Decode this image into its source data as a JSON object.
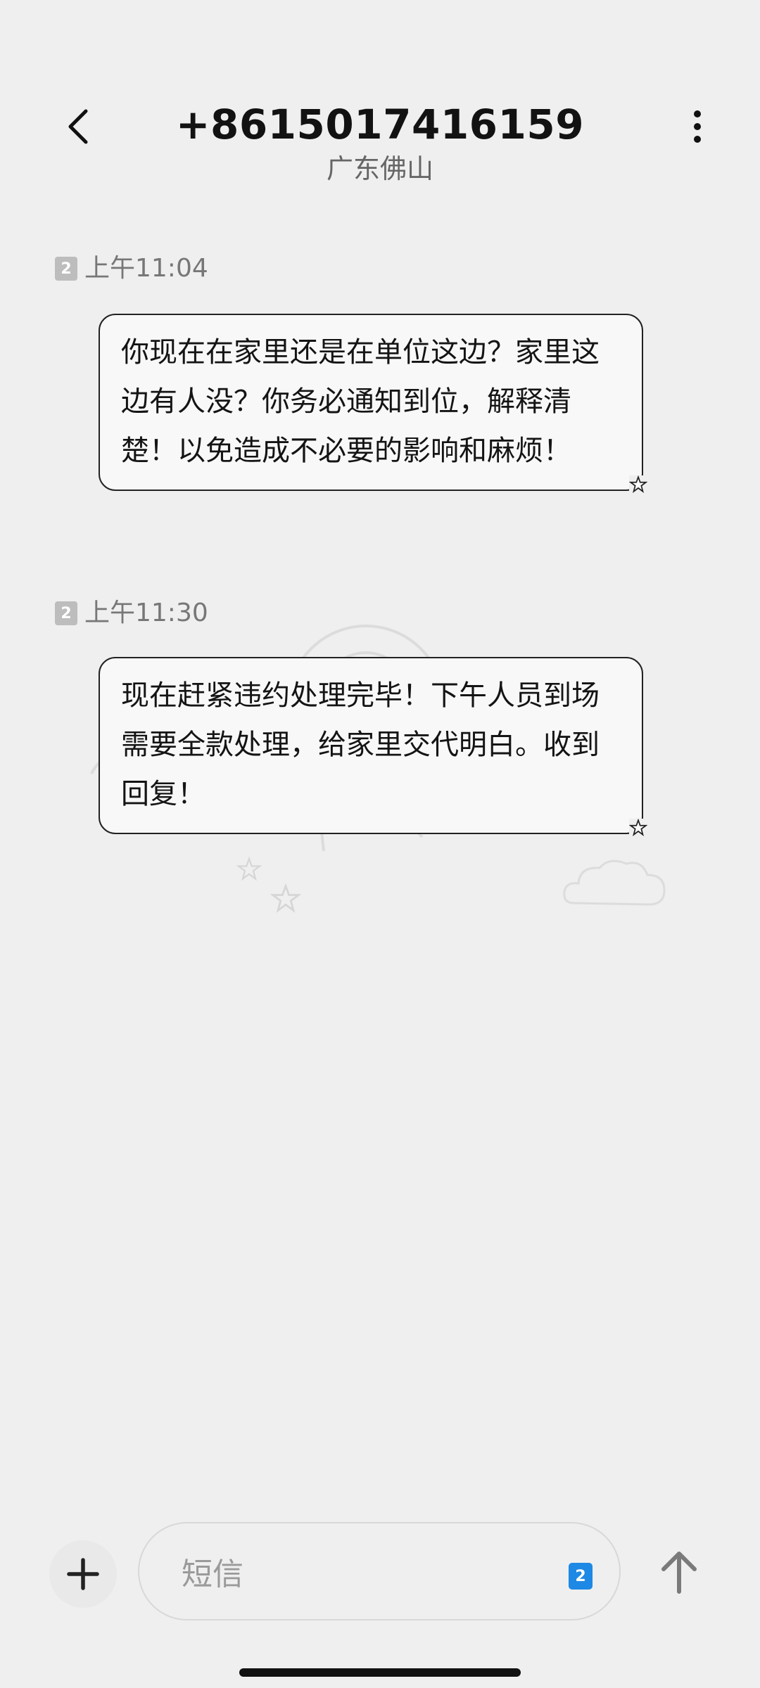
{
  "header": {
    "back_icon": "chevron-left-icon",
    "contact_number": "+8615017416159",
    "contact_location": "广东佛山",
    "menu_icon": "more-vertical-icon"
  },
  "messages": [
    {
      "sim": "2",
      "time": "上午11:04",
      "text": "你现在在家里还是在单位这边？家里这边有人没？你务必通知到位，解释清楚！以免造成不必要的影响和麻烦！"
    },
    {
      "sim": "2",
      "time": "上午11:30",
      "text": "现在赶紧违约处理完毕！下午人员到场需要全款处理，给家里交代明白。收到回复！"
    }
  ],
  "composer": {
    "add_icon": "plus-icon",
    "placeholder": "短信",
    "sim_badge": "2",
    "send_icon": "arrow-up-icon"
  },
  "colors": {
    "background": "#efefef",
    "bubble": "#f8f8f8",
    "sim_badge_active": "#1e88e5"
  }
}
